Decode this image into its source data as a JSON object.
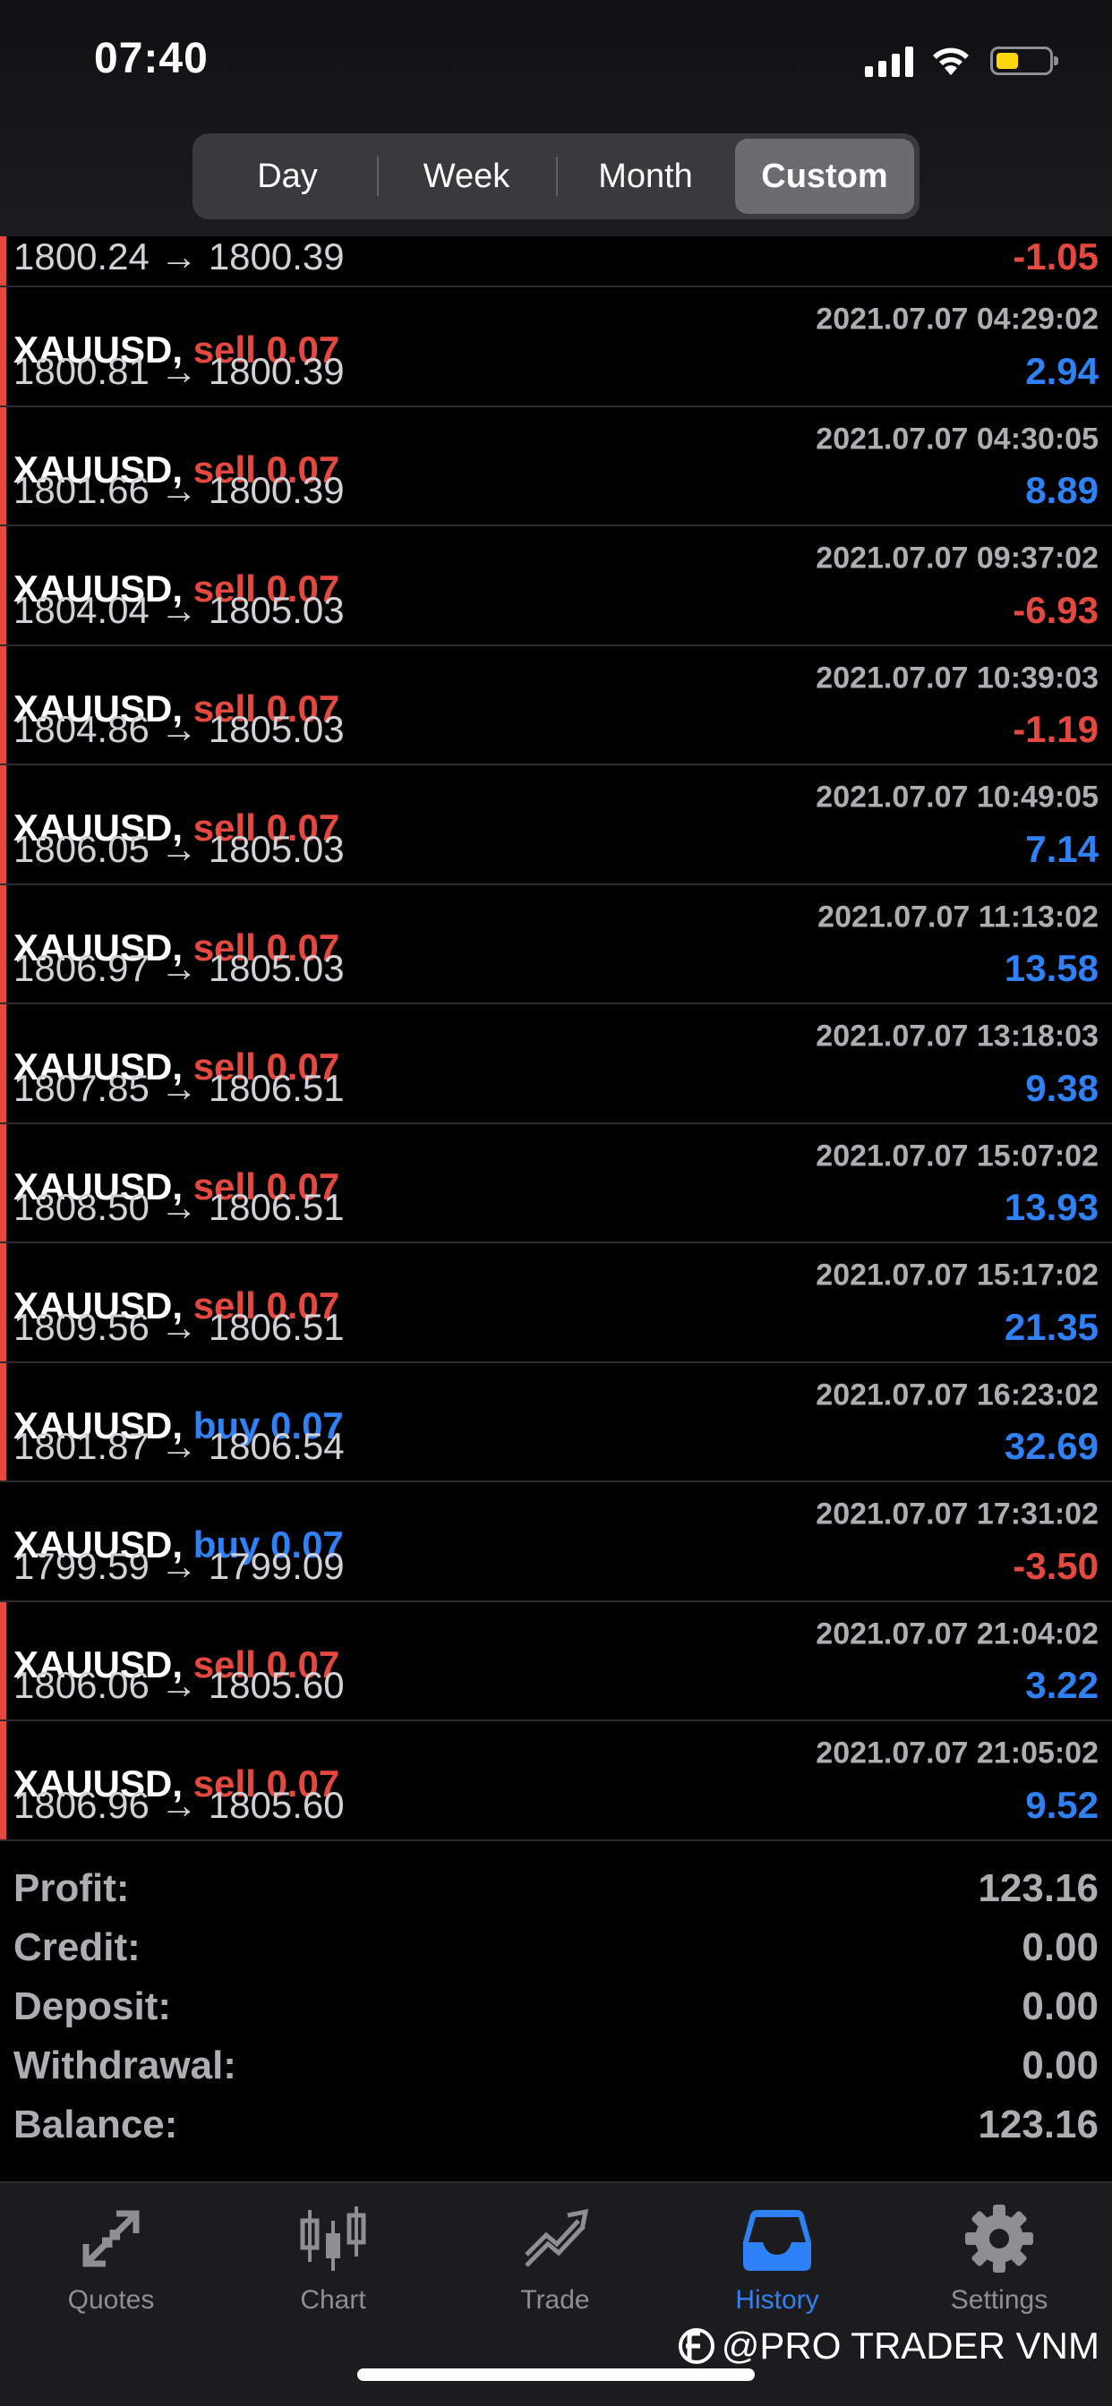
{
  "status_bar": {
    "time": "07:40",
    "battery_color": "#ffd60a"
  },
  "period_tabs": {
    "items": [
      "Day",
      "Week",
      "Month",
      "Custom"
    ],
    "active": "Custom"
  },
  "colors": {
    "sell": "#e5483f",
    "buy": "#2f81f7",
    "loss": "#e5483f",
    "gain": "#2f81f7"
  },
  "trades": [
    {
      "symbol": "",
      "side": "",
      "volume": "",
      "time": "",
      "open": "1800.24",
      "close": "1800.39",
      "profit": "-1.05",
      "bar": "#e5483f",
      "partial": true
    },
    {
      "symbol": "XAUUSD,",
      "side": "sell",
      "volume": "0.07",
      "time": "2021.07.07 04:29:02",
      "open": "1800.81",
      "close": "1800.39",
      "profit": "2.94",
      "bar": "#e5483f"
    },
    {
      "symbol": "XAUUSD,",
      "side": "sell",
      "volume": "0.07",
      "time": "2021.07.07 04:30:05",
      "open": "1801.66",
      "close": "1800.39",
      "profit": "8.89",
      "bar": "#e5483f"
    },
    {
      "symbol": "XAUUSD,",
      "side": "sell",
      "volume": "0.07",
      "time": "2021.07.07 09:37:02",
      "open": "1804.04",
      "close": "1805.03",
      "profit": "-6.93",
      "bar": "#e5483f"
    },
    {
      "symbol": "XAUUSD,",
      "side": "sell",
      "volume": "0.07",
      "time": "2021.07.07 10:39:03",
      "open": "1804.86",
      "close": "1805.03",
      "profit": "-1.19",
      "bar": "#e5483f"
    },
    {
      "symbol": "XAUUSD,",
      "side": "sell",
      "volume": "0.07",
      "time": "2021.07.07 10:49:05",
      "open": "1806.05",
      "close": "1805.03",
      "profit": "7.14",
      "bar": "#e5483f"
    },
    {
      "symbol": "XAUUSD,",
      "side": "sell",
      "volume": "0.07",
      "time": "2021.07.07 11:13:02",
      "open": "1806.97",
      "close": "1805.03",
      "profit": "13.58",
      "bar": "#e5483f"
    },
    {
      "symbol": "XAUUSD,",
      "side": "sell",
      "volume": "0.07",
      "time": "2021.07.07 13:18:03",
      "open": "1807.85",
      "close": "1806.51",
      "profit": "9.38",
      "bar": "#e5483f"
    },
    {
      "symbol": "XAUUSD,",
      "side": "sell",
      "volume": "0.07",
      "time": "2021.07.07 15:07:02",
      "open": "1808.50",
      "close": "1806.51",
      "profit": "13.93",
      "bar": "#e5483f"
    },
    {
      "symbol": "XAUUSD,",
      "side": "sell",
      "volume": "0.07",
      "time": "2021.07.07 15:17:02",
      "open": "1809.56",
      "close": "1806.51",
      "profit": "21.35",
      "bar": "#e5483f"
    },
    {
      "symbol": "XAUUSD,",
      "side": "buy",
      "volume": "0.07",
      "time": "2021.07.07 16:23:02",
      "open": "1801.87",
      "close": "1806.54",
      "profit": "32.69",
      "bar": "#e5483f"
    },
    {
      "symbol": "XAUUSD,",
      "side": "buy",
      "volume": "0.07",
      "time": "2021.07.07 17:31:02",
      "open": "1799.59",
      "close": "1799.09",
      "profit": "-3.50",
      "bar": ""
    },
    {
      "symbol": "XAUUSD,",
      "side": "sell",
      "volume": "0.07",
      "time": "2021.07.07 21:04:02",
      "open": "1806.06",
      "close": "1805.60",
      "profit": "3.22",
      "bar": "#e5483f"
    },
    {
      "symbol": "XAUUSD,",
      "side": "sell",
      "volume": "0.07",
      "time": "2021.07.07 21:05:02",
      "open": "1806.96",
      "close": "1805.60",
      "profit": "9.52",
      "bar": "#e5483f"
    }
  ],
  "arrow": "→",
  "summary": {
    "profit_label": "Profit:",
    "profit": "123.16",
    "credit_label": "Credit:",
    "credit": "0.00",
    "deposit_label": "Deposit:",
    "deposit": "0.00",
    "withdrawal_label": "Withdrawal:",
    "withdrawal": "0.00",
    "balance_label": "Balance:",
    "balance": "123.16"
  },
  "tabbar": {
    "items": [
      {
        "label": "Quotes",
        "icon": "quotes-icon"
      },
      {
        "label": "Chart",
        "icon": "candlestick-chart-icon"
      },
      {
        "label": "Trade",
        "icon": "trade-trend-icon"
      },
      {
        "label": "History",
        "icon": "inbox-tray-icon"
      },
      {
        "label": "Settings",
        "icon": "gear-icon"
      }
    ],
    "active": "History"
  },
  "watermark": "@PRO TRADER VNM"
}
